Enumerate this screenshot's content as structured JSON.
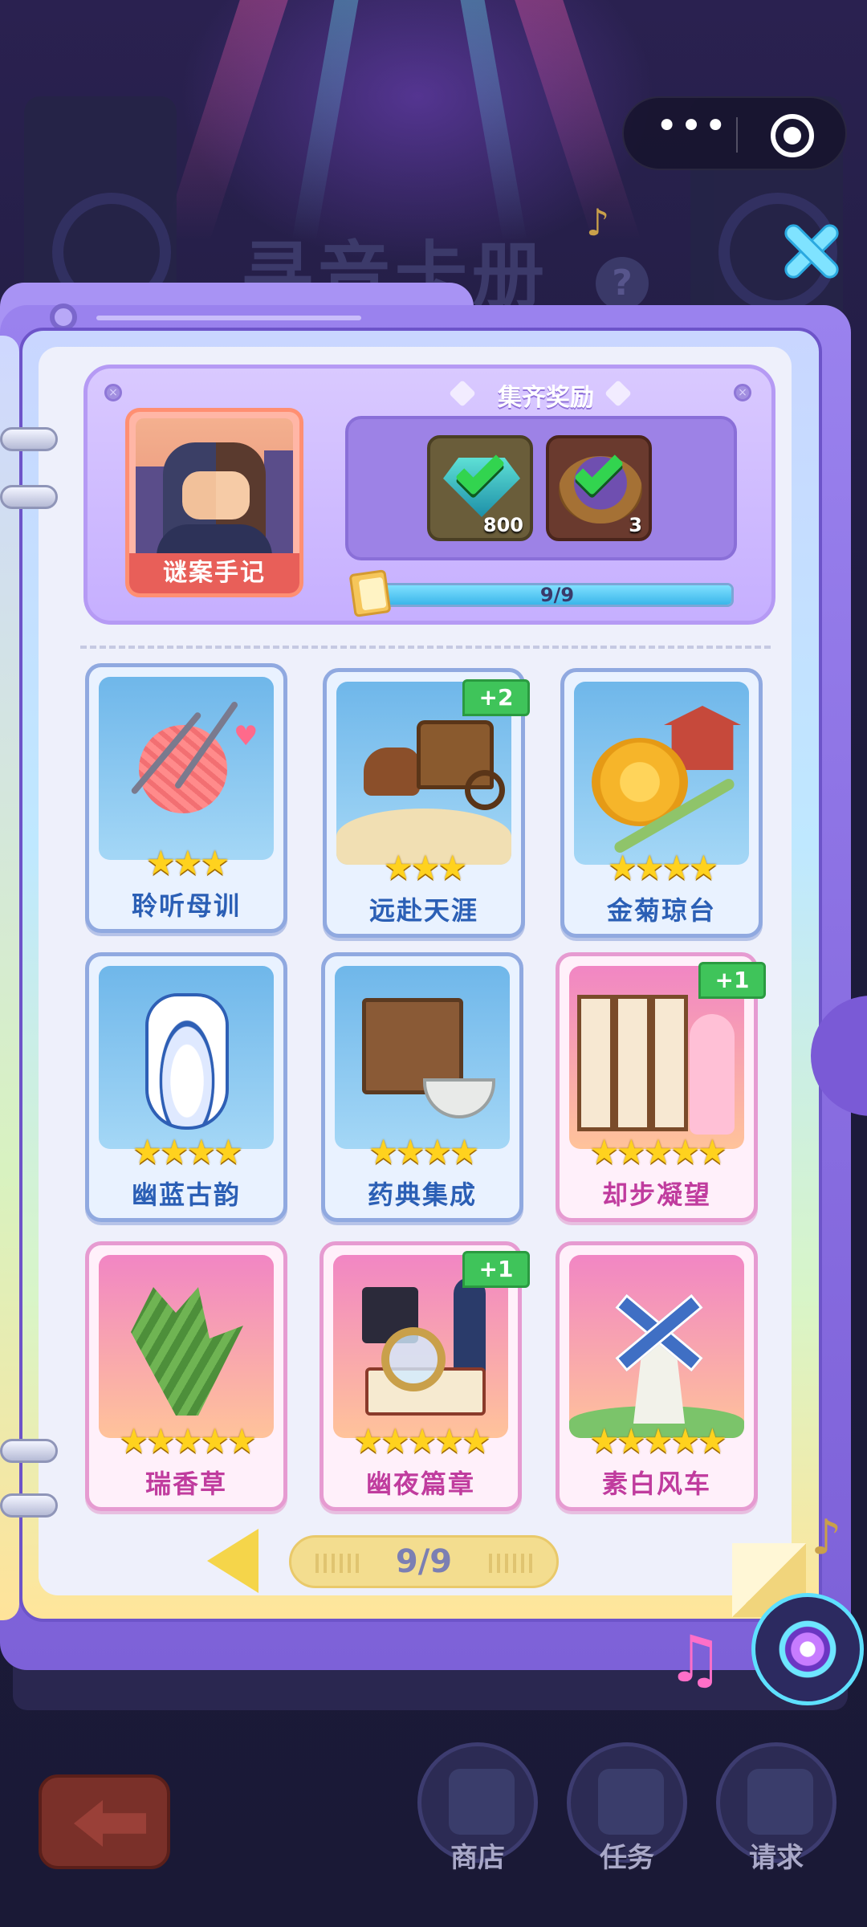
{
  "top_capsule": {
    "menu_label": "•••"
  },
  "background_title": "寻音卡册",
  "help_label": "?",
  "reward": {
    "title": "集齐奖励",
    "album_name": "谜案手记",
    "items": [
      {
        "icon": "gem-icon",
        "count": "800",
        "claimed": true
      },
      {
        "icon": "dish-icon",
        "count": "3",
        "claimed": true
      }
    ],
    "progress_text": "9/9",
    "progress": 1.0
  },
  "cards": [
    {
      "name": "聆听母训",
      "stars": "★★★",
      "theme": "blue",
      "art": "yarn-icon",
      "badge": ""
    },
    {
      "name": "远赴天涯",
      "stars": "★★★",
      "theme": "blue",
      "art": "carriage-icon",
      "badge": "+2"
    },
    {
      "name": "金菊琼台",
      "stars": "★★★★",
      "theme": "blue",
      "art": "chrysanthemum-icon",
      "badge": ""
    },
    {
      "name": "幽蓝古韵",
      "stars": "★★★★",
      "theme": "blue",
      "art": "vase-icon",
      "badge": ""
    },
    {
      "name": "药典集成",
      "stars": "★★★★",
      "theme": "blue",
      "art": "medicine-cabinet-icon",
      "badge": ""
    },
    {
      "name": "却步凝望",
      "stars": "★★★★★",
      "theme": "pink",
      "art": "folding-screen-icon",
      "badge": "+1"
    },
    {
      "name": "瑞香草",
      "stars": "★★★★★",
      "theme": "pink",
      "art": "rosemary-icon",
      "badge": ""
    },
    {
      "name": "幽夜篇章",
      "stars": "★★★★★",
      "theme": "pink",
      "art": "magnifier-book-icon",
      "badge": "+1"
    },
    {
      "name": "素白风车",
      "stars": "★★★★★",
      "theme": "pink",
      "art": "windmill-icon",
      "badge": ""
    }
  ],
  "pager": {
    "text": "9/9"
  },
  "bottom_nav": [
    {
      "label": "商店",
      "icon": "shop-icon"
    },
    {
      "label": "任务",
      "icon": "task-icon"
    },
    {
      "label": "请求",
      "icon": "request-icon"
    }
  ],
  "colors": {
    "page_bg": "#1c1b3a",
    "album_purple": "#8a6fe2",
    "blue_card_text": "#2b5fb5",
    "pink_card_text": "#c03c9e",
    "star": "#ffd21e",
    "badge_green": "#3fc45a"
  }
}
